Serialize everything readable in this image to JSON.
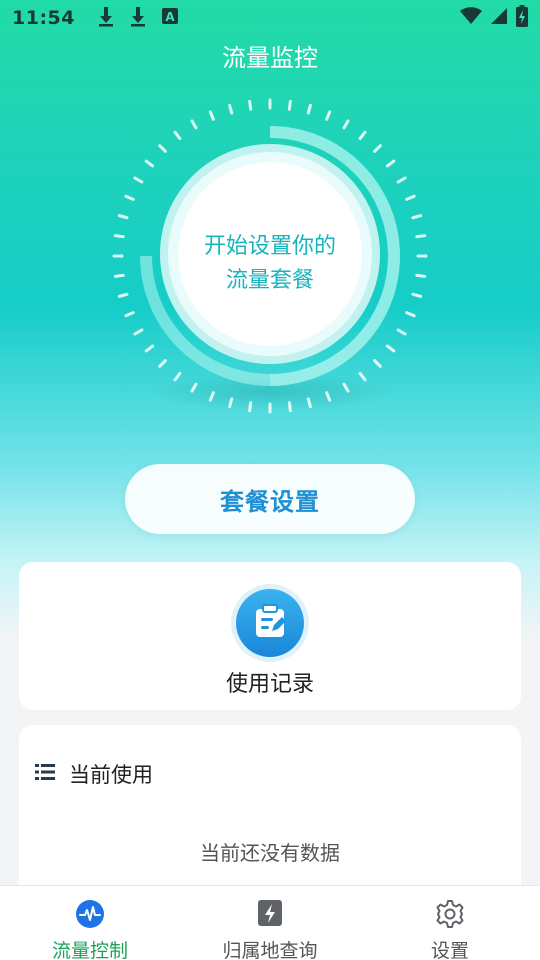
{
  "status_bar": {
    "time": "11:54",
    "left_icons": [
      "download-icon",
      "download-icon",
      "accessibility-a-icon"
    ],
    "right_icons": [
      "wifi-icon",
      "signal-icon",
      "battery-charging-icon"
    ]
  },
  "app": {
    "title": "流量监控"
  },
  "gauge": {
    "line1": "开始设置你的",
    "line2": "流量套餐"
  },
  "plan_button": {
    "label": "套餐设置"
  },
  "usage_card": {
    "label": "使用记录",
    "icon": "clipboard-edit-icon"
  },
  "current_card": {
    "header": "当前使用",
    "header_icon": "list-icon",
    "empty_text": "当前还没有数据"
  },
  "bottom_nav": {
    "items": [
      {
        "label": "流量控制",
        "icon": "pulse-icon",
        "active": true
      },
      {
        "label": "归属地查询",
        "icon": "phone-lightning-icon",
        "active": false
      },
      {
        "label": "设置",
        "icon": "gear-icon",
        "active": false
      }
    ]
  },
  "colors": {
    "accent_green": "#1aa35a",
    "button_text_blue": "#1f8fd6",
    "gauge_text": "#16b4bd",
    "hero_top": "#22dba6",
    "hero_mid": "#16cdc8"
  }
}
